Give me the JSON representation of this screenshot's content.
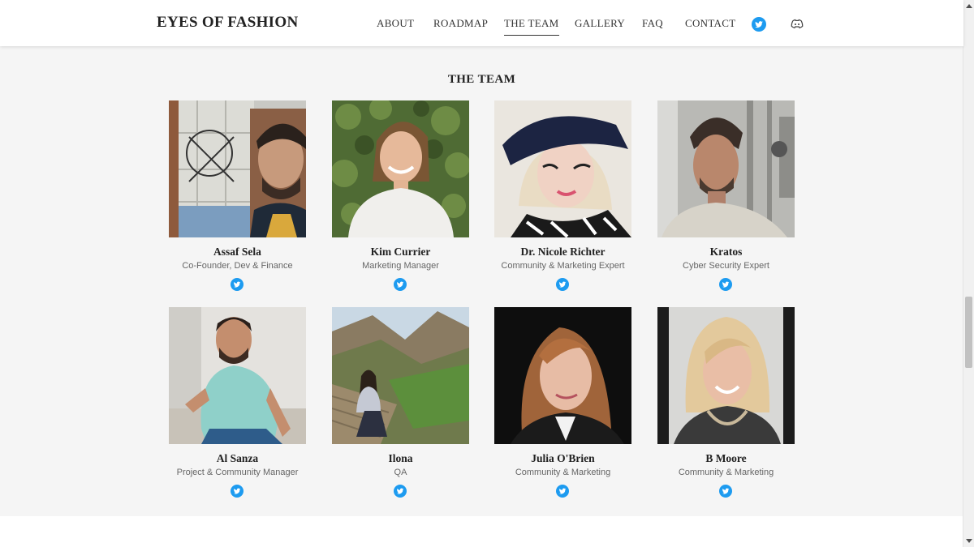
{
  "header": {
    "logo": "EYES OF FASHION",
    "nav": [
      {
        "label": "ABOUT",
        "active": false
      },
      {
        "label": "ROADMAP",
        "active": false
      },
      {
        "label": "THE TEAM",
        "active": true
      },
      {
        "label": "GALLERY",
        "active": false
      },
      {
        "label": "FAQ",
        "active": false
      },
      {
        "label": "CONTACT",
        "active": false
      }
    ],
    "icons": [
      "twitter-icon",
      "discord-icon"
    ]
  },
  "team": {
    "title": "THE TEAM",
    "members": [
      {
        "name": "Assaf Sela",
        "role": "Co-Founder, Dev & Finance",
        "icon": "twitter-icon"
      },
      {
        "name": "Kim Currier",
        "role": "Marketing Manager",
        "icon": "twitter-icon"
      },
      {
        "name": "Dr. Nicole Richter",
        "role": "Community & Marketing Expert",
        "icon": "twitter-icon"
      },
      {
        "name": "Kratos",
        "role": "Cyber Security Expert",
        "icon": "twitter-icon"
      },
      {
        "name": "Al Sanza",
        "role": "Project & Community Manager",
        "icon": "twitter-icon"
      },
      {
        "name": "Ilona",
        "role": "QA",
        "icon": "twitter-icon"
      },
      {
        "name": "Julia O'Brien",
        "role": "Community & Marketing",
        "icon": "twitter-icon"
      },
      {
        "name": "B Moore",
        "role": "Community & Marketing",
        "icon": "twitter-icon"
      }
    ]
  },
  "colors": {
    "twitter": "#1d9bf0",
    "background": "#f5f5f5",
    "header": "#ffffff"
  }
}
